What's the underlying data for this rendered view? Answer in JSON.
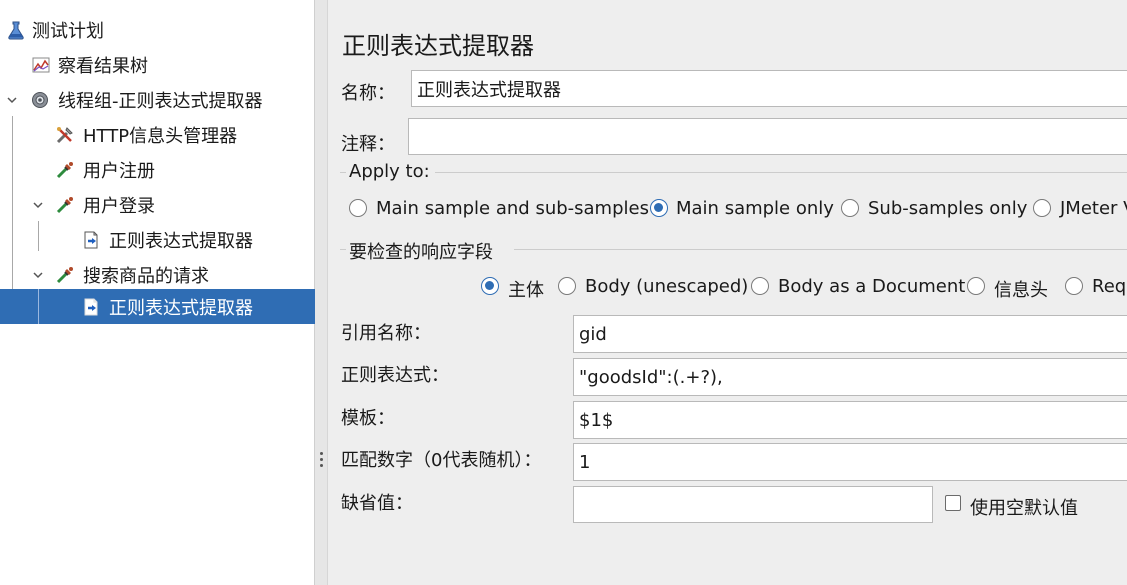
{
  "tree": {
    "items": [
      {
        "label": "测试计划",
        "icon": "flask-icon"
      },
      {
        "label": "察看结果树",
        "icon": "chart-icon"
      },
      {
        "label": "线程组-正则表达式提取器",
        "icon": "gear-icon"
      },
      {
        "label": "HTTP信息头管理器",
        "icon": "wrench-icon"
      },
      {
        "label": "用户注册",
        "icon": "pipette-icon"
      },
      {
        "label": "用户登录",
        "icon": "pipette-icon"
      },
      {
        "label": "正则表达式提取器",
        "icon": "extractor-icon"
      },
      {
        "label": "搜索商品的请求",
        "icon": "pipette-icon"
      },
      {
        "label": "正则表达式提取器",
        "icon": "extractor-icon",
        "selected": true
      }
    ]
  },
  "panel": {
    "title": "正则表达式提取器",
    "name_label": "名称：",
    "name_value": "正则表达式提取器",
    "comment_label": "注释：",
    "comment_value": "",
    "apply_to": {
      "heading": "Apply to:",
      "options": [
        "Main sample and sub-samples",
        "Main sample only",
        "Sub-samples only",
        "JMeter V"
      ],
      "selected": "Main sample only"
    },
    "field_to_check": {
      "heading": "要检查的响应字段",
      "options": [
        "主体",
        "Body (unescaped)",
        "Body as a Document",
        "信息头",
        "Requ"
      ],
      "selected": "主体"
    },
    "ref_name_label": "引用名称：",
    "ref_name_value": "gid",
    "regex_label": "正则表达式：",
    "regex_value": "\"goodsId\":(.+?),",
    "template_label": "模板：",
    "template_value": "$1$",
    "match_no_label": "匹配数字（0代表随机）：",
    "match_no_value": "1",
    "default_label": "缺省值：",
    "default_value": "",
    "use_empty_default_label": "使用空默认值",
    "use_empty_default_checked": false
  },
  "colors": {
    "selection": "#2f6db4",
    "panel_bg": "#eeeeee"
  }
}
